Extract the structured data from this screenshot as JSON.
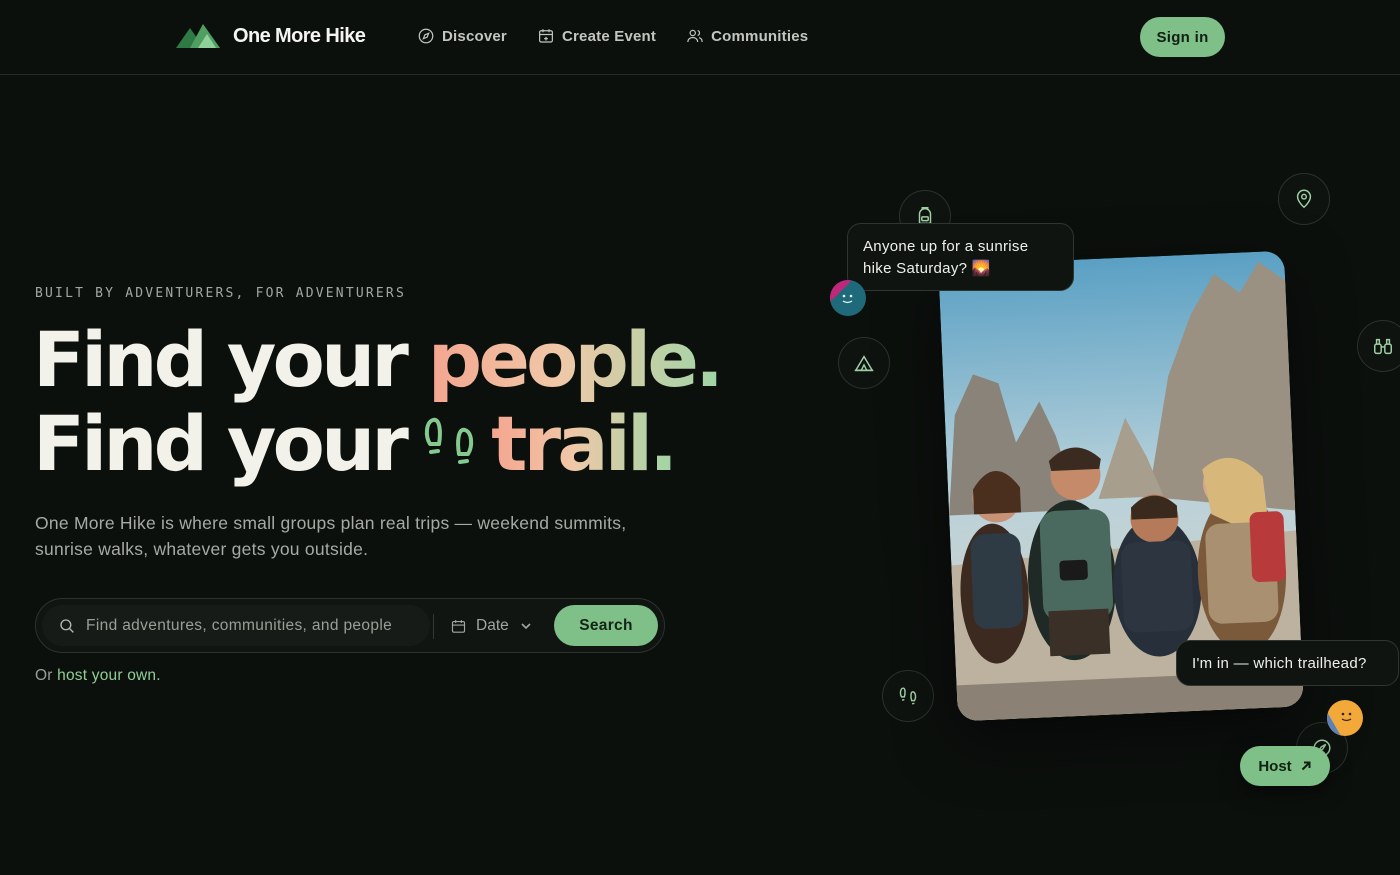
{
  "brand": {
    "name": "One More Hike",
    "logo_icon": "mountains-logo-icon",
    "accent": "#7fbf88"
  },
  "nav": {
    "items": [
      {
        "label": "Discover",
        "icon": "compass-icon"
      },
      {
        "label": "Create Event",
        "icon": "calendar-plus-icon"
      },
      {
        "label": "Communities",
        "icon": "users-icon"
      }
    ],
    "sign_in": "Sign in"
  },
  "hero": {
    "eyebrow": "BUILT BY ADVENTURERS, FOR ADVENTURERS",
    "line1_prefix": "Find your",
    "line1_highlight": "people.",
    "line2_prefix": "Find your",
    "line2_icon": "footprints-icon",
    "line2_highlight": "trail.",
    "subtitle": "One More Hike is where small groups plan real trips — weekend summits, sunrise walks, whatever gets you outside.",
    "gradient": [
      "#f4a58f",
      "#f0c8a8",
      "#9fd5a5"
    ]
  },
  "search": {
    "placeholder": "Find adventures, communities, and people",
    "date_label": "Date",
    "button": "Search"
  },
  "host_line": {
    "prefix": "Or",
    "link": "host your own."
  },
  "showcase": {
    "bubble_top": "Anyone up for a sunrise hike Saturday? 🌄",
    "bubble_bottom": "I'm in — which trailhead?",
    "host_button": "Host",
    "floating_icons": [
      "backpack-icon",
      "map-pin-icon",
      "tent-icon",
      "binoculars-icon",
      "footprints-icon",
      "compass-icon"
    ]
  }
}
